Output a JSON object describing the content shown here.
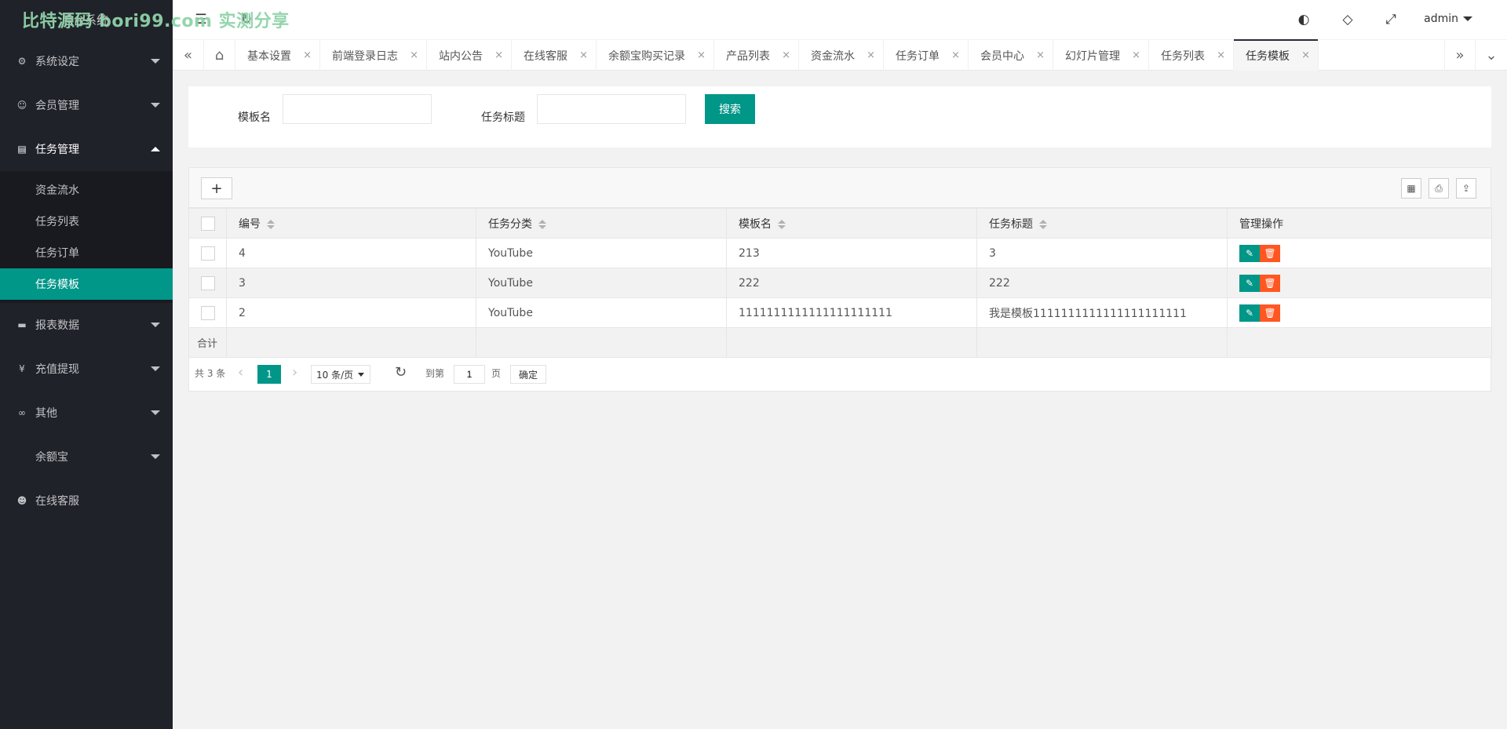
{
  "watermark": "比特源码 bori99.com 实测分享",
  "logo": {
    "text": "后台系统"
  },
  "colors": {
    "accent": "#009688",
    "danger": "#ff5722",
    "sidebar": "#20222a"
  },
  "sidebar": {
    "menu": [
      {
        "label": "系统设定",
        "icon": "gear-icon",
        "glyph": "⚙"
      },
      {
        "label": "会员管理",
        "icon": "user-icon",
        "glyph": "☺"
      },
      {
        "label": "任务管理",
        "icon": "file-icon",
        "glyph": "▤"
      }
    ],
    "submenu": [
      {
        "label": "资金流水"
      },
      {
        "label": "任务列表"
      },
      {
        "label": "任务订单"
      },
      {
        "label": "任务模板"
      }
    ],
    "menu_after": [
      {
        "label": "报表数据",
        "icon": "chat-icon",
        "glyph": "▬"
      },
      {
        "label": "充值提现",
        "icon": "yen-icon",
        "glyph": "¥"
      },
      {
        "label": "其他",
        "icon": "link-icon",
        "glyph": "∞"
      },
      {
        "label": "余额宝"
      },
      {
        "label": "在线客服",
        "icon": "headset-icon",
        "glyph": "☻"
      }
    ]
  },
  "header": {
    "menu_glyph": "☰",
    "refresh_glyph": "↻",
    "theme_glyph": "◐",
    "tag_glyph": "◇",
    "fullscreen_glyph": "⤢",
    "user": "admin"
  },
  "tabs": {
    "prev_glyph": "«",
    "next_glyph": "»",
    "more_glyph": "⌄",
    "home_glyph": "⌂",
    "close_glyph": "×",
    "items": [
      {
        "label": "基本设置"
      },
      {
        "label": "前端登录日志"
      },
      {
        "label": "站内公告"
      },
      {
        "label": "在线客服"
      },
      {
        "label": "余额宝购买记录"
      },
      {
        "label": "产品列表"
      },
      {
        "label": "资金流水"
      },
      {
        "label": "任务订单"
      },
      {
        "label": "会员中心"
      },
      {
        "label": "幻灯片管理"
      },
      {
        "label": "任务列表"
      },
      {
        "label": "任务模板"
      }
    ]
  },
  "search": {
    "label_template": "模板名",
    "label_title": "任务标题",
    "button": "搜索"
  },
  "table": {
    "add_glyph": "+",
    "tool_columns_glyph": "▦",
    "tool_print_glyph": "⎙",
    "tool_export_glyph": "⇪",
    "columns": {
      "id": "编号",
      "category": "任务分类",
      "template": "模板名",
      "title": "任务标题",
      "actions": "管理操作"
    },
    "rows": [
      {
        "id": "4",
        "category": "YouTube",
        "template": "213",
        "title": "3"
      },
      {
        "id": "3",
        "category": "YouTube",
        "template": "222",
        "title": "222"
      },
      {
        "id": "2",
        "category": "YouTube",
        "template": "1111111111111111111111",
        "title": "我是模板1111111111111111111111"
      }
    ],
    "edit_glyph": "✎",
    "delete_glyph": "🗑",
    "total_label": "合计"
  },
  "pager": {
    "total": "共 3 条",
    "prev": "‹",
    "current": "1",
    "next": "›",
    "per_page": "10 条/页",
    "refresh": "↻",
    "goto": "到第",
    "page_value": "1",
    "page_suffix": "页",
    "confirm": "确定"
  }
}
